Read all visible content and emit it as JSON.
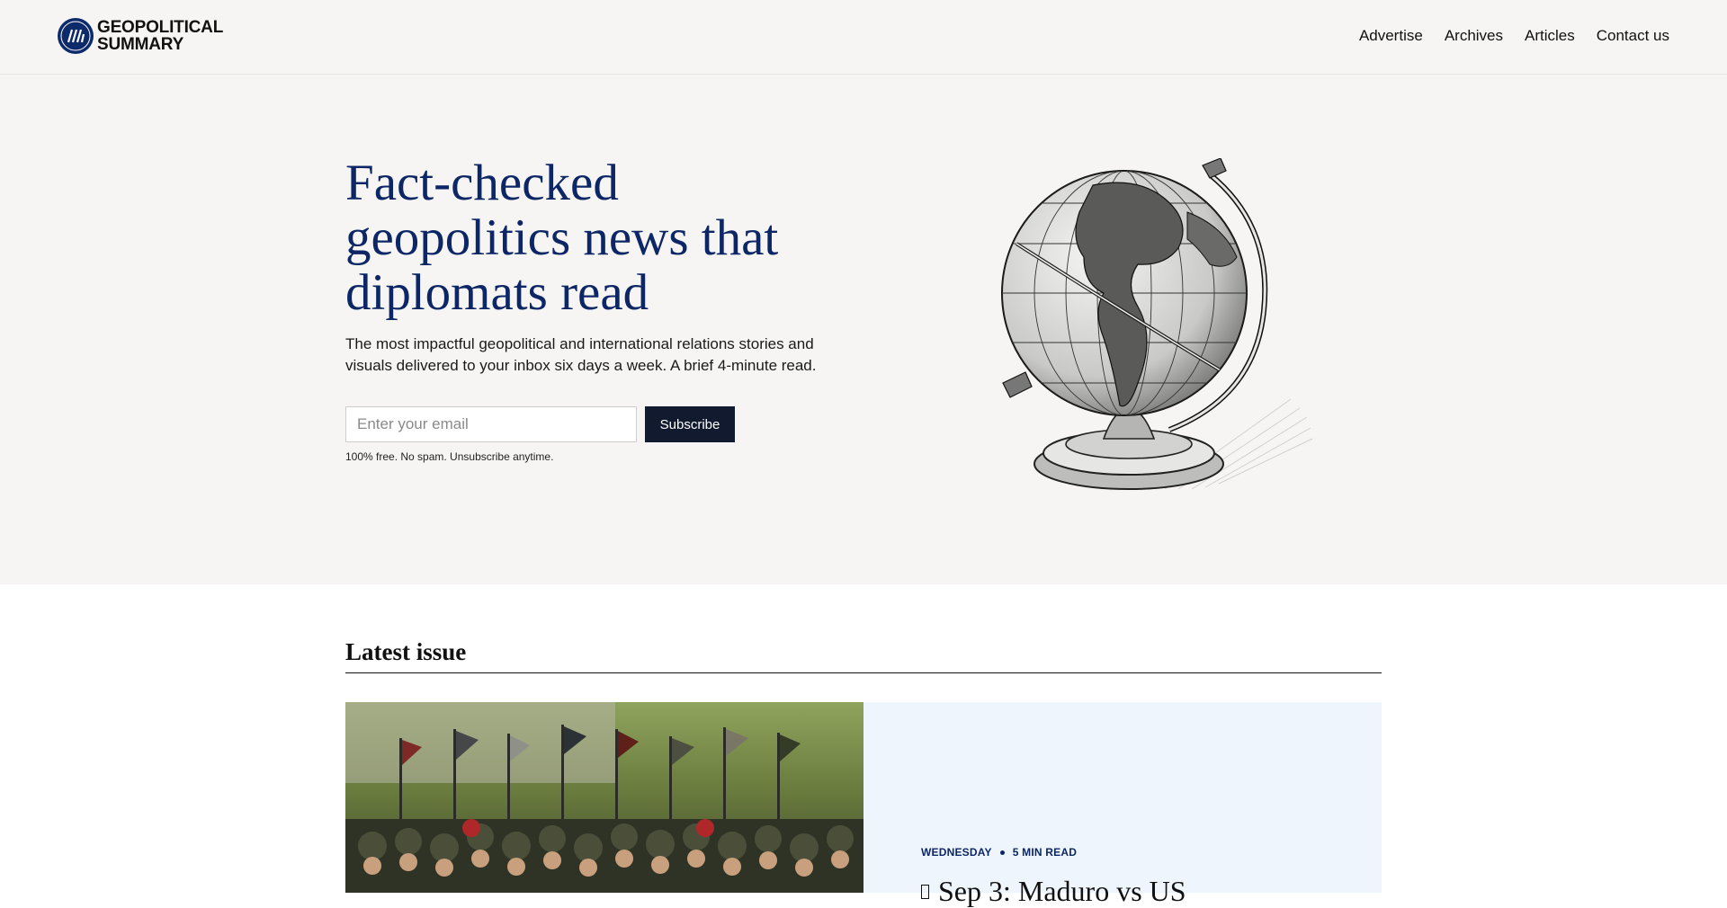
{
  "header": {
    "logo_line1": "GEOPOLITICAL",
    "logo_line2": "SUMMARY",
    "nav": [
      "Advertise",
      "Archives",
      "Articles",
      "Contact us"
    ]
  },
  "hero": {
    "title": "Fact-checked geopolitics news that diplomats read",
    "subtitle": "The most impactful geopolitical and international relations stories and visuals delivered to your inbox six days a week. A brief 4-minute read.",
    "email_placeholder": "Enter your email",
    "subscribe_label": "Subscribe",
    "fineprint": "100% free. No spam. Unsubscribe anytime."
  },
  "latest": {
    "heading": "Latest issue",
    "card": {
      "day": "WEDNESDAY",
      "read_time": "5 MIN READ",
      "title": "Sep 3: Maduro vs US"
    }
  },
  "colors": {
    "brand_navy": "#0d2766",
    "header_bg": "#f6f5f3",
    "button_bg": "#111a2e",
    "card_bg": "#eef5fc"
  }
}
